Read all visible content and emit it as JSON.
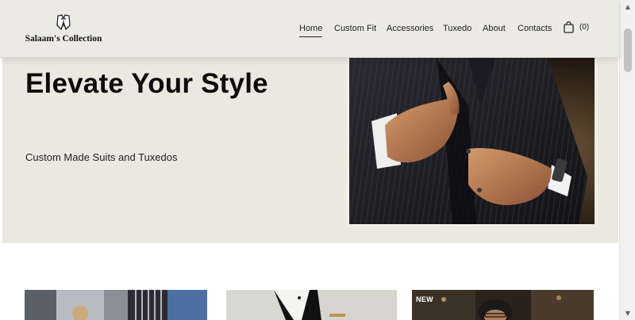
{
  "brand": {
    "name": "Salaam's Collection",
    "logo_icon": "tuxedo-icon"
  },
  "nav": {
    "items": [
      "Home",
      "Custom Fit",
      "Accessories",
      "Tuxedo",
      "About",
      "Contacts"
    ],
    "active": "Home"
  },
  "cart": {
    "icon": "shopping-bag-icon",
    "count_label": "(0)"
  },
  "hero": {
    "title": "Elevate Your Style",
    "subtitle": "Custom Made Suits and Tuxedos",
    "image_icon": "suit-photo"
  },
  "products": {
    "cards": [
      {
        "badge": ""
      },
      {
        "badge": ""
      },
      {
        "badge": "NEW"
      }
    ]
  },
  "colors": {
    "hero_bg": "#ebe9df",
    "header_bg": "#ecebe3",
    "text": "#111111"
  }
}
